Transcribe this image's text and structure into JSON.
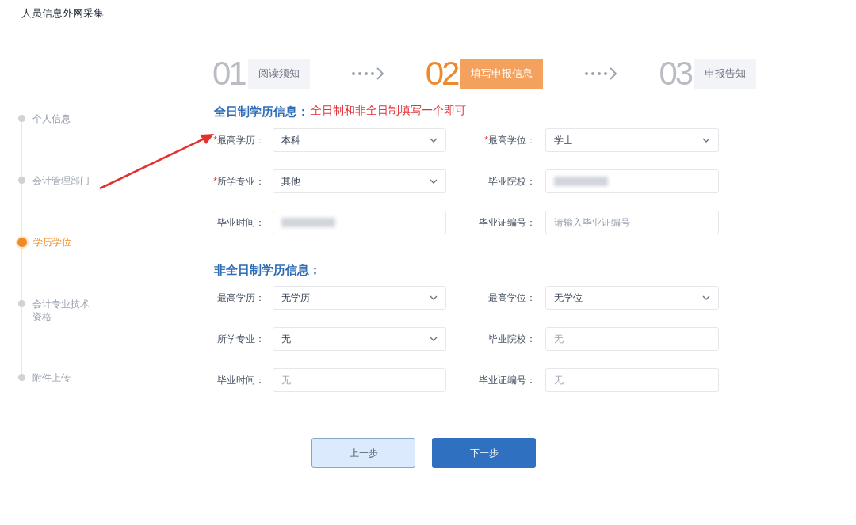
{
  "header": {
    "title": "人员信息外网采集"
  },
  "steps": [
    {
      "number": "01",
      "label": "阅读须知",
      "selected": false
    },
    {
      "number": "02",
      "label": "填写申报信息",
      "selected": true
    },
    {
      "number": "03",
      "label": "申报告知",
      "selected": false
    }
  ],
  "sidebar": {
    "items": [
      {
        "label": "个人信息",
        "selected": false
      },
      {
        "label": "会计管理部门",
        "selected": false
      },
      {
        "label": "学历学位",
        "selected": true
      },
      {
        "label": "会计专业技术资格",
        "selected": false
      },
      {
        "label": "附件上传",
        "selected": false
      }
    ]
  },
  "sections": [
    {
      "title": "全日制学历信息：",
      "note": "全日制和非全日制填写一个即可",
      "fields": [
        {
          "label": "最高学历：",
          "marker": "*",
          "kind": "select",
          "value": "本科"
        },
        {
          "label": "最高学位：",
          "marker": "*",
          "kind": "select",
          "value": "学士"
        },
        {
          "label": "所学专业：",
          "marker": "*",
          "kind": "select",
          "value": "其他"
        },
        {
          "label": "毕业院校：",
          "kind": "input",
          "redacted": true
        },
        {
          "label": "毕业时间：",
          "kind": "input",
          "redacted": true
        },
        {
          "label": "毕业证编号：",
          "kind": "input",
          "placeholder": "请输入毕业证编号"
        }
      ]
    },
    {
      "title": "非全日制学历信息：",
      "fields": [
        {
          "label": "最高学历：",
          "kind": "select",
          "value": "无学历"
        },
        {
          "label": "最高学位：",
          "kind": "select",
          "value": "无学位"
        },
        {
          "label": "所学专业：",
          "kind": "select",
          "value": "无"
        },
        {
          "label": "毕业院校：",
          "kind": "input",
          "placeholder": "无"
        },
        {
          "label": "毕业时间：",
          "kind": "input",
          "placeholder": "无"
        },
        {
          "label": "毕业证编号：",
          "kind": "input",
          "placeholder": "无"
        }
      ]
    }
  ],
  "buttons": [
    {
      "label": "上一步",
      "kind": "secondary"
    },
    {
      "label": "下一步",
      "kind": "primary"
    }
  ]
}
